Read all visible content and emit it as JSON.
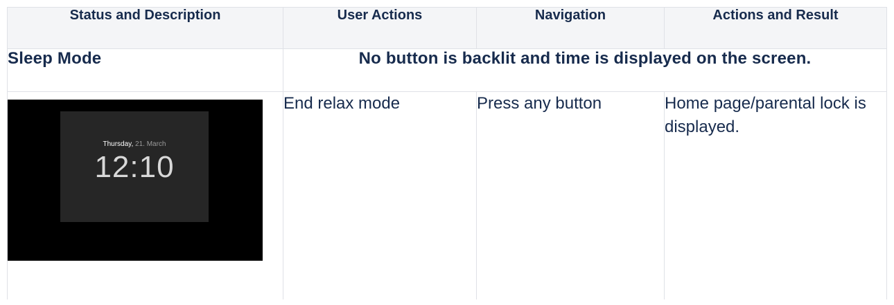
{
  "table": {
    "headers": [
      "Status and Description",
      "User Actions",
      "Navigation",
      "Actions and Result"
    ],
    "mode": {
      "title": "Sleep Mode",
      "description": "No button is backlit and time is displayed on the screen."
    },
    "screen": {
      "day": "Thursday,",
      "date": "21. March",
      "time": "12:10"
    },
    "row": {
      "user_action": "End relax mode",
      "navigation": "Press any button",
      "result": "Home page/parental lock is displayed."
    }
  },
  "colors": {
    "header_background": "#f4f5f7",
    "border": "#dfe1e6",
    "text": "#172b4d",
    "screen_background": "#000000",
    "screen_panel": "#262626"
  }
}
